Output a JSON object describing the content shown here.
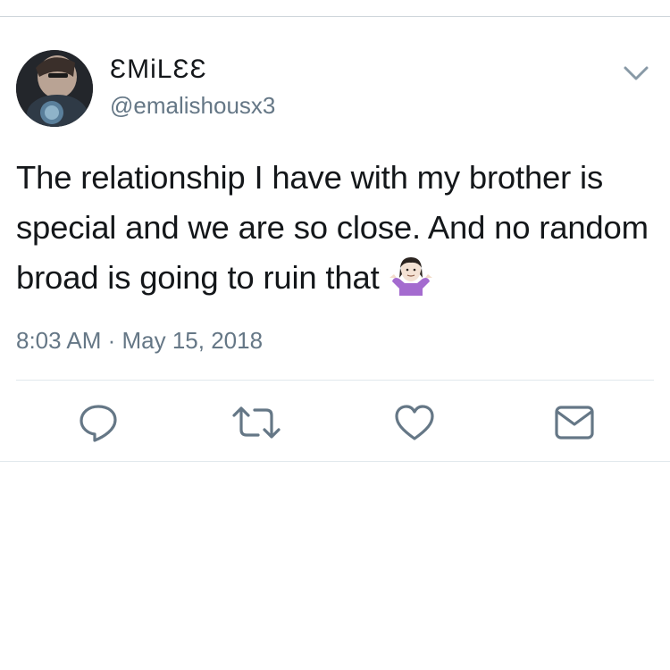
{
  "tweet": {
    "author": {
      "display_name": "ƐMiLƐƐ",
      "handle": "@emalishousx3",
      "avatar": "profile-photo"
    },
    "text": "The relationship I have with my brother is special and we are so close. And no random broad is going to ruin that",
    "emoji": "person-shrugging-emoji",
    "timestamp": "8:03 AM · May 15, 2018"
  },
  "actions": {
    "reply_icon": "reply-icon",
    "retweet_icon": "retweet-icon",
    "like_icon": "heart-icon",
    "dm_icon": "envelope-icon"
  },
  "colors": {
    "text": "#14171a",
    "secondary": "#657786",
    "divider": "#e1e8ed",
    "icon": "#657786"
  }
}
